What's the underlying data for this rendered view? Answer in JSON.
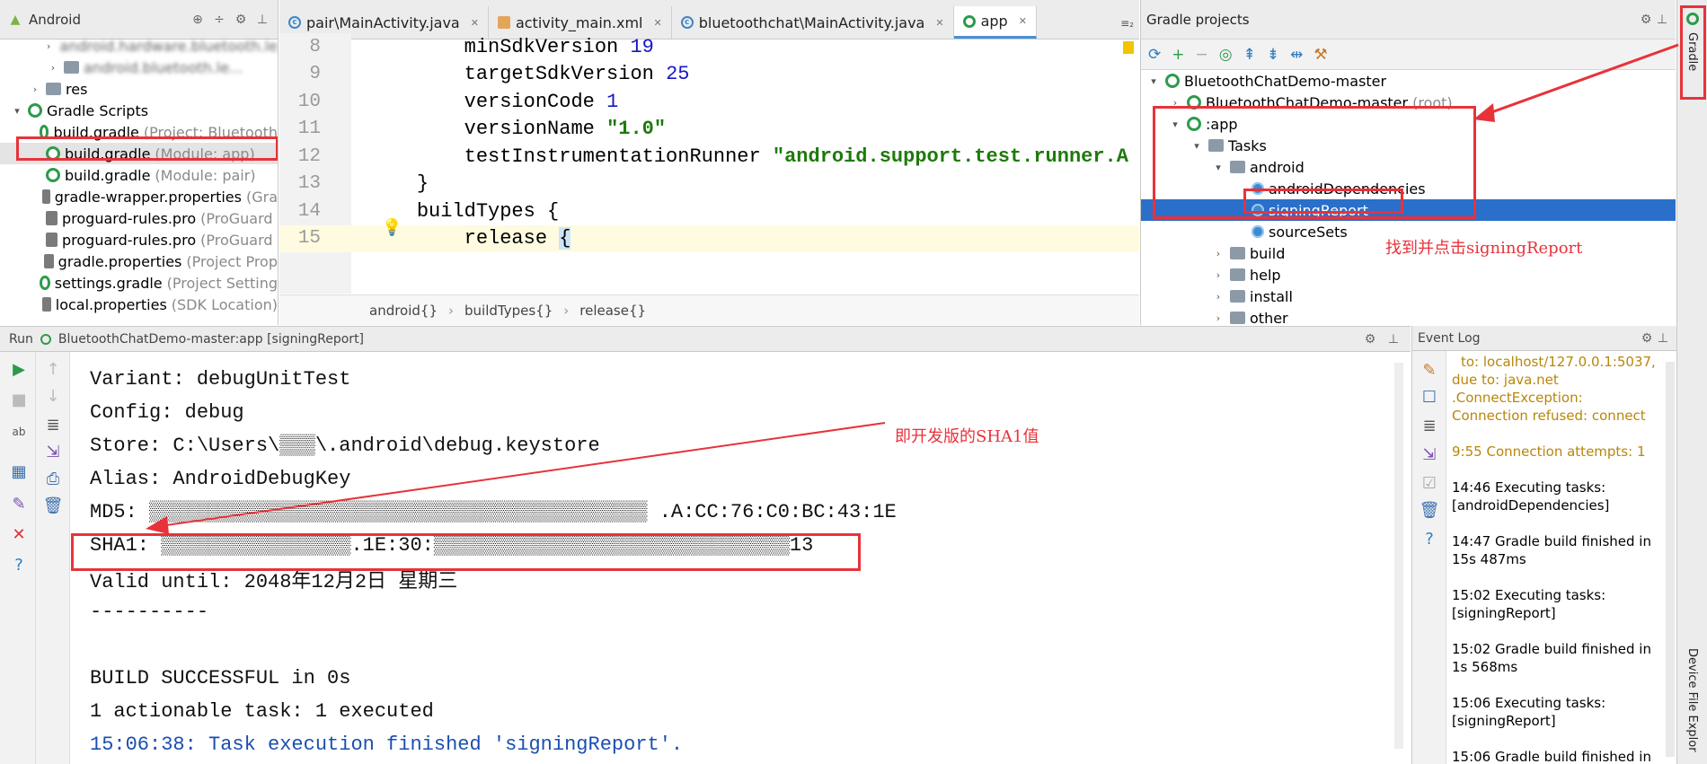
{
  "project_panel": {
    "view_selector": "Android",
    "items": [
      {
        "label": "android.hardware.bluetooth.le...",
        "dim": "",
        "depth": 3,
        "kind": "folder",
        "blurred": true
      },
      {
        "label": "android.bluetooth.le...",
        "dim": "",
        "depth": 3,
        "kind": "folder",
        "blurred": true
      },
      {
        "label": "res",
        "dim": "",
        "depth": 2,
        "kind": "folder",
        "blurred": false
      },
      {
        "label": "Gradle Scripts",
        "dim": "",
        "depth": 1,
        "kind": "gradle",
        "blurred": false
      },
      {
        "label": "build.gradle",
        "dim": "(Project: Bluetooth",
        "depth": 2,
        "kind": "gradle",
        "blurred": false
      },
      {
        "label": "build.gradle",
        "dim": "(Module: app)",
        "depth": 2,
        "kind": "gradle",
        "blurred": false,
        "highlighted": true
      },
      {
        "label": "build.gradle",
        "dim": "(Module: pair)",
        "depth": 2,
        "kind": "gradle",
        "blurred": false
      },
      {
        "label": "gradle-wrapper.properties",
        "dim": "(Gra",
        "depth": 2,
        "kind": "file",
        "blurred": false
      },
      {
        "label": "proguard-rules.pro",
        "dim": "(ProGuard",
        "depth": 2,
        "kind": "file",
        "blurred": false
      },
      {
        "label": "proguard-rules.pro",
        "dim": "(ProGuard",
        "depth": 2,
        "kind": "file",
        "blurred": false
      },
      {
        "label": "gradle.properties",
        "dim": "(Project Prop",
        "depth": 2,
        "kind": "file",
        "blurred": false
      },
      {
        "label": "settings.gradle",
        "dim": "(Project Setting",
        "depth": 2,
        "kind": "gradle",
        "blurred": false
      },
      {
        "label": "local.properties",
        "dim": "(SDK Location)",
        "depth": 2,
        "kind": "file",
        "blurred": false
      }
    ]
  },
  "editor": {
    "tabs": [
      {
        "label": "pair\\MainActivity.java",
        "icon": "class",
        "active": false
      },
      {
        "label": "activity_main.xml",
        "icon": "xml",
        "active": false
      },
      {
        "label": "bluetoothchat\\MainActivity.java",
        "icon": "class",
        "active": false
      },
      {
        "label": "app",
        "icon": "gradle",
        "active": true
      }
    ],
    "tab_overflow": "≡₂",
    "lines": [
      {
        "num": "8",
        "indent": "        ",
        "text": "minSdkVersion ",
        "value": "19",
        "value_kind": "num"
      },
      {
        "num": "9",
        "indent": "        ",
        "text": "targetSdkVersion ",
        "value": "25",
        "value_kind": "num"
      },
      {
        "num": "10",
        "indent": "        ",
        "text": "versionCode ",
        "value": "1",
        "value_kind": "num"
      },
      {
        "num": "11",
        "indent": "        ",
        "text": "versionName ",
        "value": "\"1.0\"",
        "value_kind": "str"
      },
      {
        "num": "12",
        "indent": "        ",
        "text": "testInstrumentationRunner ",
        "value": "\"android.support.test.runner.A",
        "value_kind": "str"
      },
      {
        "num": "13",
        "indent": "    ",
        "text": "}",
        "value": "",
        "value_kind": ""
      },
      {
        "num": "14",
        "indent": "    ",
        "text": "buildTypes {",
        "value": "",
        "value_kind": ""
      },
      {
        "num": "15",
        "indent": "        ",
        "text": "release ",
        "value": "{",
        "value_kind": "brk"
      }
    ],
    "breadcrumb": [
      "android{}",
      "buildTypes{}",
      "release{}"
    ]
  },
  "gradle_panel": {
    "title": "Gradle projects",
    "toolbar": [
      "refresh-icon",
      "add-icon",
      "remove-icon",
      "run-icon",
      "expand-all-icon",
      "collapse-all-icon",
      "link-icon",
      "settings-icon"
    ],
    "tree": [
      {
        "label": "BluetoothChatDemo-master",
        "dim": "",
        "depth": 0,
        "arrow": "down",
        "icon": "gradle"
      },
      {
        "label": "BluetoothChatDemo-master",
        "dim": "(root)",
        "depth": 1,
        "arrow": "right",
        "icon": "gradle"
      },
      {
        "label": ":app",
        "dim": "",
        "depth": 1,
        "arrow": "down",
        "icon": "gradle"
      },
      {
        "label": "Tasks",
        "dim": "",
        "depth": 2,
        "arrow": "down",
        "icon": "folder"
      },
      {
        "label": "android",
        "dim": "",
        "depth": 3,
        "arrow": "down",
        "icon": "folder"
      },
      {
        "label": "androidDependencies",
        "dim": "",
        "depth": 4,
        "arrow": "",
        "icon": "cog"
      },
      {
        "label": "signingReport",
        "dim": "",
        "depth": 4,
        "arrow": "",
        "icon": "cog",
        "selected": true
      },
      {
        "label": "sourceSets",
        "dim": "",
        "depth": 4,
        "arrow": "",
        "icon": "cog"
      },
      {
        "label": "build",
        "dim": "",
        "depth": 3,
        "arrow": "right",
        "icon": "folder"
      },
      {
        "label": "help",
        "dim": "",
        "depth": 3,
        "arrow": "right",
        "icon": "folder"
      },
      {
        "label": "install",
        "dim": "",
        "depth": 3,
        "arrow": "right",
        "icon": "folder"
      },
      {
        "label": "other",
        "dim": "",
        "depth": 3,
        "arrow": "right",
        "icon": "folder"
      }
    ],
    "annotation": "找到并点击signingReport"
  },
  "right_stripe": {
    "gradle": "Gradle",
    "device_explorer": "Device File Explor"
  },
  "run_panel": {
    "title": "Run",
    "config": "BluetoothChatDemo-master:app [signingReport]",
    "lines": [
      {
        "text": "Variant: debugUnitTest",
        "color": "normal"
      },
      {
        "text": "Config: debug",
        "color": "normal"
      },
      {
        "text": "Store: C:\\Users\\▒▒▒\\.android\\debug.keystore",
        "color": "normal"
      },
      {
        "text": "Alias: AndroidDebugKey",
        "color": "normal"
      },
      {
        "text": "MD5: ▒▒▒▒▒▒▒▒▒▒▒▒▒▒▒▒▒▒▒▒▒▒▒▒▒▒▒▒▒▒▒▒▒▒▒▒▒▒▒▒▒▒ .A:CC:76:C0:BC:43:1E",
        "color": "normal"
      },
      {
        "text": "SHA1: ▒▒▒▒▒▒▒▒▒▒▒▒▒▒▒▒.1E:30:▒▒▒▒▒▒▒▒▒▒▒▒▒▒▒▒▒▒▒▒▒▒▒▒▒▒▒▒▒▒13",
        "color": "normal"
      },
      {
        "text": "Valid until: 2048年12月2日 星期三",
        "color": "normal"
      },
      {
        "text": "----------",
        "color": "normal"
      },
      {
        "text": "",
        "color": "normal"
      },
      {
        "text": "BUILD SUCCESSFUL in 0s",
        "color": "normal"
      },
      {
        "text": "1 actionable task: 1 executed",
        "color": "normal"
      },
      {
        "text": "15:06:38: Task execution finished 'signingReport'.",
        "color": "blue"
      }
    ],
    "annotation": "即开发版的SHA1值"
  },
  "event_log": {
    "title": "Event Log",
    "entries": [
      {
        "time": "",
        "text": "to: localhost/127.0.0.1:5037, due to: java.net .ConnectException: Connection refused: connect",
        "warn": true
      },
      {
        "time": "9:55",
        "text": "Connection attempts: 1",
        "warn": true
      },
      {
        "time": "14:46",
        "text": "Executing tasks: [androidDependencies]",
        "warn": false
      },
      {
        "time": "14:47",
        "text": "Gradle build finished in 15s 487ms",
        "warn": false
      },
      {
        "time": "15:02",
        "text": "Executing tasks: [signingReport]",
        "warn": false
      },
      {
        "time": "15:02",
        "text": "Gradle build finished in 1s 568ms",
        "warn": false
      },
      {
        "time": "15:06",
        "text": "Executing tasks: [signingReport]",
        "warn": false
      },
      {
        "time": "15:06",
        "text": "Gradle build finished in",
        "warn": false
      }
    ]
  },
  "colors": {
    "annotation_red": "#e8323a",
    "selection_blue": "#2a6fc9",
    "gradle_green": "#2e9a4b"
  }
}
